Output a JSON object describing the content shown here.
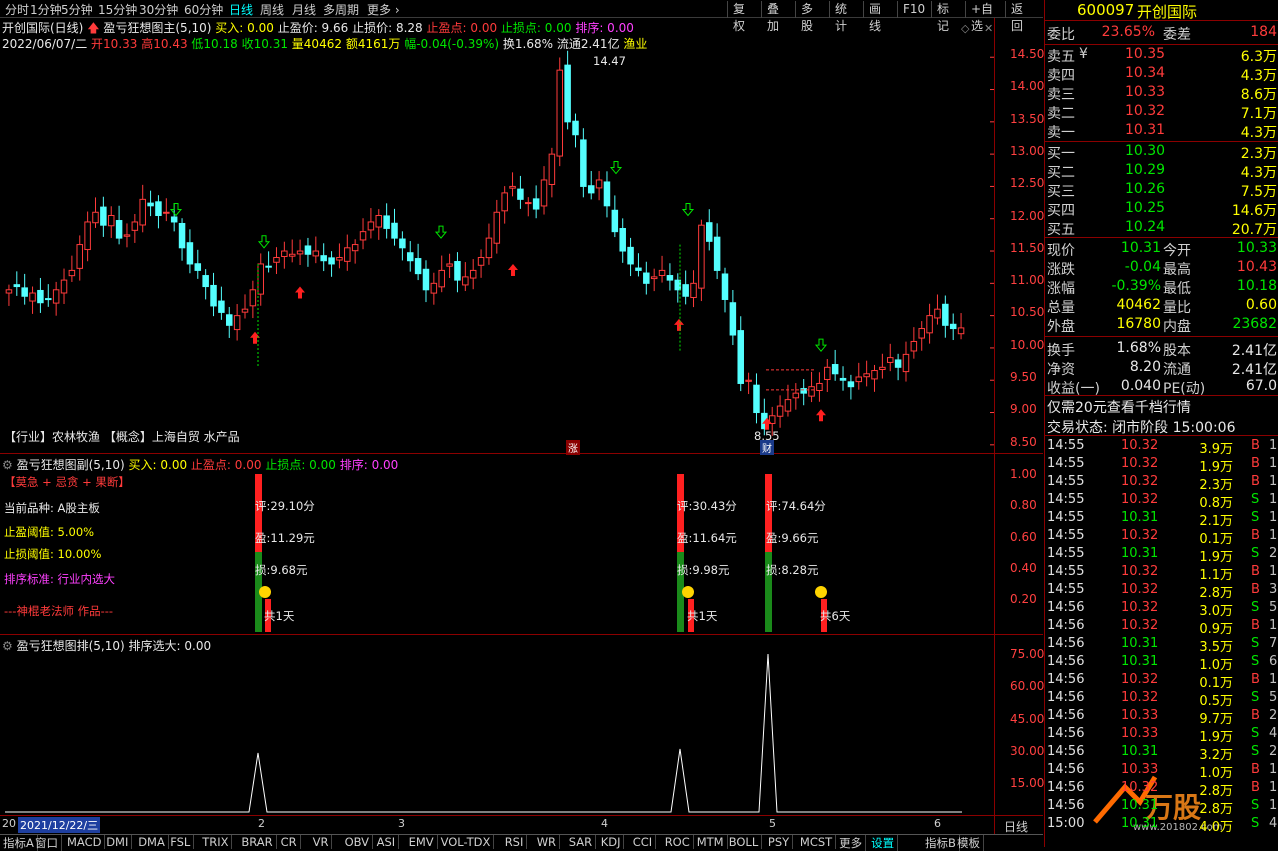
{
  "periods": [
    "分时",
    "1分钟",
    "5分钟",
    "15分钟",
    "30分钟",
    "60分钟",
    "日线",
    "周线",
    "月线",
    "多周期",
    "更多 ›"
  ],
  "tools": [
    "复权",
    "叠加",
    "多股",
    "统计",
    "画线",
    "F10",
    "标记",
    "+自选",
    "返回"
  ],
  "info1": {
    "title": "开创国际(日线)",
    "ind": "盈亏狂想图主(5,10)",
    "buy": "买入: 0.00",
    "tp": "止盈价: 9.66",
    "sl": "止损价: 8.28",
    "tpp": "止盈点: 0.00",
    "slp": "止损点: 0.00",
    "rank": "排序: 0.00"
  },
  "info2": {
    "date": "2022/06/07/二",
    "open": "开10.33",
    "high": "高10.43",
    "low": "低10.18",
    "close": "收10.31",
    "vol": "量40462",
    "amt": "额4161万",
    "chg": "幅-0.04(-0.39%)",
    "turn": "换1.68%",
    "float": "流通2.41亿",
    "sector": "渔业"
  },
  "price_axis": [
    "14.50",
    "14.00",
    "13.50",
    "13.00",
    "12.50",
    "12.00",
    "11.50",
    "11.00",
    "10.50",
    "10.00",
    "9.50",
    "9.00",
    "8.50"
  ],
  "mid_axis": [
    "1.00",
    "0.80",
    "0.60",
    "0.40",
    "0.20"
  ],
  "bot_axis": [
    "75.00",
    "60.00",
    "45.00",
    "30.00",
    "15.00"
  ],
  "high_label": "14.47",
  "low_label": "8.55",
  "concept": "【行业】农林牧渔 【概念】上海自贸 水产品",
  "event1": "涨",
  "event2": "财",
  "mid_header": {
    "title": "盈亏狂想图副(5,10)",
    "buy": "买入: 0.00",
    "tpp": "止盈点: 0.00",
    "slp": "止损点: 0.00",
    "rank": "排序: 0.00"
  },
  "panel": {
    "tag": "【莫急 + 忌贪 + 果断】",
    "variety": "当前品种:  A股主板",
    "tp_th": "止盈阈值:  5.00%",
    "sl_th": "止损阈值:  10.00%",
    "sort": "排序标准:  行业内选大",
    "author": "---神棍老法师 作品---"
  },
  "signals": [
    {
      "score": "评:29.10分",
      "profit": "盈:11.29元",
      "loss": "损:9.68元",
      "days": "共1天"
    },
    {
      "score": "评:30.43分",
      "profit": "盈:11.64元",
      "loss": "损:9.98元",
      "days": "共1天"
    },
    {
      "score": "评:74.64分",
      "profit": "盈:9.66元",
      "loss": "损:8.28元",
      "days": "共6天"
    }
  ],
  "bot_header": {
    "title": "盈亏狂想图排(5,10)",
    "val": "排序选大: 0.00"
  },
  "time_axis": {
    "date": "2021/12/22/三",
    "m2": "2",
    "m3": "3",
    "m4": "4",
    "m5": "5",
    "m6": "6",
    "label": "日线"
  },
  "bottom_tabs": [
    "指标A",
    "窗口",
    "MACD",
    "DMI",
    "DMA",
    "FSL",
    "TRIX",
    "BRAR",
    "CR",
    "VR",
    "OBV",
    "ASI",
    "EMV",
    "VOL-TDX",
    "RSI",
    "WR",
    "SAR",
    "KDJ",
    "CCI",
    "ROC",
    "MTM",
    "BOLL",
    "PSY",
    "MCST",
    "更多",
    "设置",
    "指标B",
    "模板"
  ],
  "stock": {
    "code": "600097",
    "name": "开创国际"
  },
  "ratio": {
    "wb_label": "委比",
    "wb": "23.65%",
    "wc_label": "委差",
    "wc": "184"
  },
  "asks": [
    {
      "label": "卖五",
      "yen": "¥",
      "price": "10.35",
      "vol": "6.3万"
    },
    {
      "label": "卖四",
      "price": "10.34",
      "vol": "4.3万"
    },
    {
      "label": "卖三",
      "price": "10.33",
      "vol": "8.6万"
    },
    {
      "label": "卖二",
      "price": "10.32",
      "vol": "7.1万"
    },
    {
      "label": "卖一",
      "price": "10.31",
      "vol": "4.3万"
    }
  ],
  "bids": [
    {
      "label": "买一",
      "price": "10.30",
      "vol": "2.3万"
    },
    {
      "label": "买二",
      "price": "10.29",
      "vol": "4.3万"
    },
    {
      "label": "买三",
      "price": "10.26",
      "vol": "7.5万"
    },
    {
      "label": "买四",
      "price": "10.25",
      "vol": "14.6万"
    },
    {
      "label": "买五",
      "price": "10.24",
      "vol": "20.7万"
    }
  ],
  "quote": [
    {
      "l1": "现价",
      "v1": "10.31",
      "l2": "今开",
      "v2": "10.33"
    },
    {
      "l1": "涨跌",
      "v1": "-0.04",
      "l2": "最高",
      "v2": "10.43"
    },
    {
      "l1": "涨幅",
      "v1": "-0.39%",
      "l2": "最低",
      "v2": "10.18"
    },
    {
      "l1": "总量",
      "v1": "40462",
      "l2": "量比",
      "v2": "0.60"
    },
    {
      "l1": "外盘",
      "v1": "16780",
      "l2": "内盘",
      "v2": "23682"
    },
    {
      "l1": "换手",
      "v1": "1.68%",
      "l2": "股本",
      "v2": "2.41亿"
    },
    {
      "l1": "净资",
      "v1": "8.20",
      "l2": "流通",
      "v2": "2.41亿"
    },
    {
      "l1": "收益(一)",
      "v1": "0.040",
      "l2": "PE(动)",
      "v2": "67.0"
    }
  ],
  "promo": "仅需20元查看千档行情",
  "trade_status": "交易状态: 闭市阶段 15:00:06",
  "trades": [
    {
      "t": "14:55",
      "p": "10.32",
      "v": "3.9万",
      "s": "B",
      "n": "1"
    },
    {
      "t": "14:55",
      "p": "10.32",
      "v": "1.9万",
      "s": "B",
      "n": "1"
    },
    {
      "t": "14:55",
      "p": "10.32",
      "v": "2.3万",
      "s": "B",
      "n": "1"
    },
    {
      "t": "14:55",
      "p": "10.32",
      "v": "0.8万",
      "s": "S",
      "n": "1"
    },
    {
      "t": "14:55",
      "p": "10.31",
      "v": "2.1万",
      "s": "S",
      "n": "1"
    },
    {
      "t": "14:55",
      "p": "10.32",
      "v": "0.1万",
      "s": "B",
      "n": "1"
    },
    {
      "t": "14:55",
      "p": "10.31",
      "v": "1.9万",
      "s": "S",
      "n": "2"
    },
    {
      "t": "14:55",
      "p": "10.32",
      "v": "1.1万",
      "s": "B",
      "n": "1"
    },
    {
      "t": "14:55",
      "p": "10.32",
      "v": "2.8万",
      "s": "B",
      "n": "3"
    },
    {
      "t": "14:56",
      "p": "10.32",
      "v": "3.0万",
      "s": "S",
      "n": "5"
    },
    {
      "t": "14:56",
      "p": "10.32",
      "v": "0.9万",
      "s": "B",
      "n": "1"
    },
    {
      "t": "14:56",
      "p": "10.31",
      "v": "3.5万",
      "s": "S",
      "n": "7"
    },
    {
      "t": "14:56",
      "p": "10.31",
      "v": "1.0万",
      "s": "S",
      "n": "6"
    },
    {
      "t": "14:56",
      "p": "10.32",
      "v": "0.1万",
      "s": "B",
      "n": "1"
    },
    {
      "t": "14:56",
      "p": "10.32",
      "v": "0.5万",
      "s": "S",
      "n": "5"
    },
    {
      "t": "14:56",
      "p": "10.33",
      "v": "9.7万",
      "s": "B",
      "n": "2"
    },
    {
      "t": "14:56",
      "p": "10.33",
      "v": "1.9万",
      "s": "S",
      "n": "4"
    },
    {
      "t": "14:56",
      "p": "10.31",
      "v": "3.2万",
      "s": "S",
      "n": "2"
    },
    {
      "t": "14:56",
      "p": "10.33",
      "v": "1.0万",
      "s": "B",
      "n": "1"
    },
    {
      "t": "14:56",
      "p": "10.32",
      "v": "2.8万",
      "s": "B",
      "n": "1"
    },
    {
      "t": "14:56",
      "p": "10.31",
      "v": "2.8万",
      "s": "S",
      "n": "1"
    },
    {
      "t": "15:00",
      "p": "10.31",
      "v": "4.0万",
      "s": "S",
      "n": "41"
    }
  ],
  "colors": {
    "up": "#ff3b3b",
    "down": "#54ffff",
    "bg": "#000000",
    "grid": "#8b0000"
  }
}
